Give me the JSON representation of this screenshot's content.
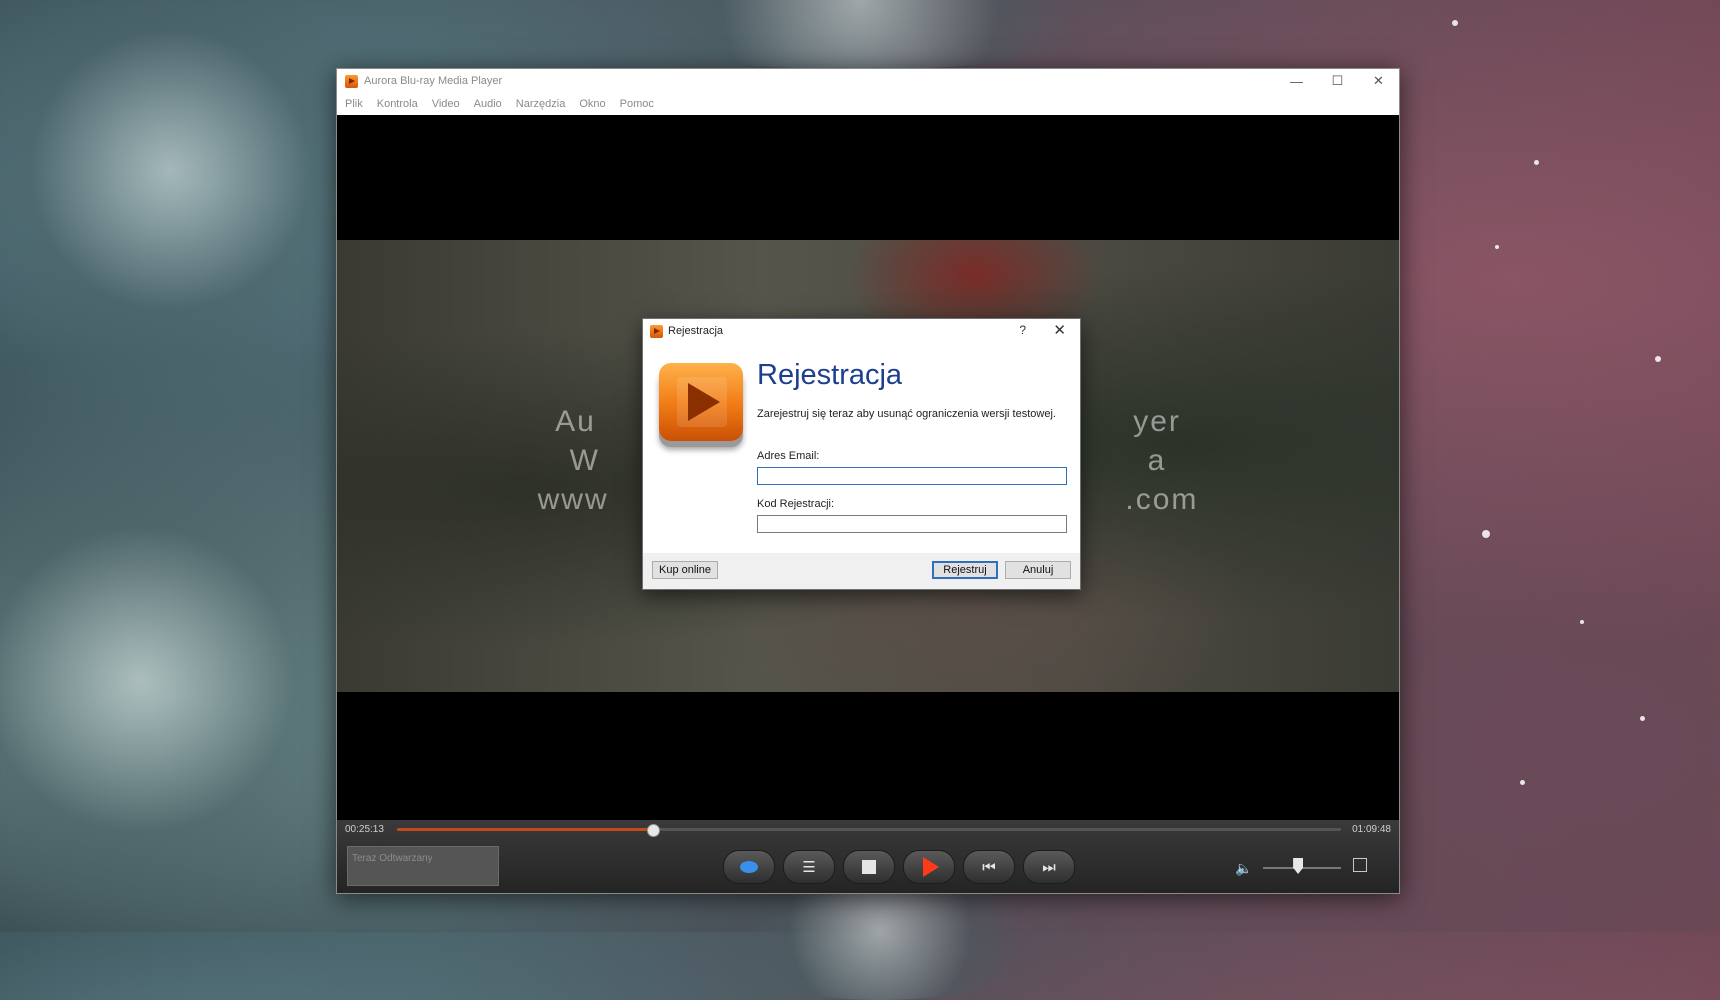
{
  "window": {
    "title": "Aurora Blu-ray Media Player",
    "menu": [
      "Plik",
      "Kontrola",
      "Video",
      "Audio",
      "Narzędzia",
      "Okno",
      "Pomoc"
    ]
  },
  "video": {
    "watermark_lines": [
      "Au                                                    yer",
      "W                                                     a",
      "www                                                  .com"
    ]
  },
  "controls": {
    "time_elapsed": "00:25:13",
    "time_total": "01:09:48",
    "progress": 0.27,
    "now_playing": "Teraz Odtwarzany",
    "volume": 0.45
  },
  "dialog": {
    "title": "Rejestracja",
    "help": "?",
    "heading": "Rejestracja",
    "description": "Zarejestruj się teraz aby usunąć ograniczenia wersji testowej.",
    "email_label": "Adres Email:",
    "email_value": "",
    "code_label": "Kod Rejestracji:",
    "code_value": "",
    "buy_button": "Kup online",
    "register_button": "Rejestruj",
    "cancel_button": "Anuluj"
  },
  "icons": {
    "close": "close-icon",
    "minimize": "minimize-icon",
    "maximize": "maximize-icon",
    "accent": "#f07a14",
    "play_color": "#ff3a1a",
    "heading_color": "#1d3f8f"
  }
}
